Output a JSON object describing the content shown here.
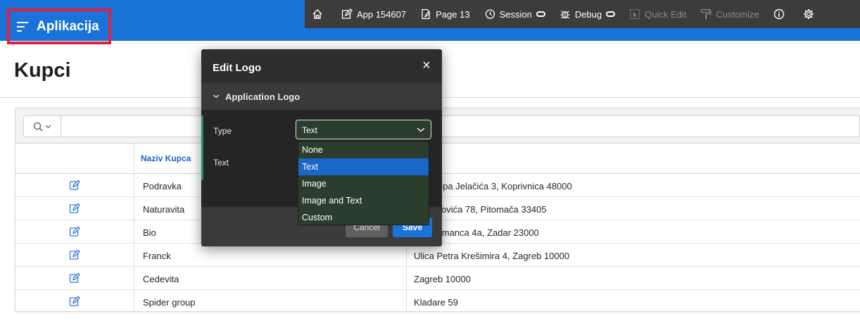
{
  "header": {
    "app_title": "Aplikacija"
  },
  "devbar": {
    "app_label": "App 154607",
    "page_label": "Page 13",
    "session_label": "Session",
    "debug_label": "Debug",
    "quick_edit_label": "Quick Edit",
    "customize_label": "Customize"
  },
  "page": {
    "title": "Kupci"
  },
  "report": {
    "column_name": "Naziv Kupca",
    "rows": [
      {
        "name": "Podravka",
        "address": "na Josipa Jelačića 3, Koprivnica 48000"
      },
      {
        "name": "Naturavita",
        "address": "Preradovića 78, Pitomača 33405"
      },
      {
        "name": "Bio",
        "address": "na Sulimanca 4a, Zadar 23000"
      },
      {
        "name": "Franck",
        "address": "Ulica Petra Krešimira 4, Zagreb 10000"
      },
      {
        "name": "Cedevita",
        "address": "Zagreb 10000"
      },
      {
        "name": "Spider group",
        "address": "Kladare 59"
      }
    ]
  },
  "dialog": {
    "title": "Edit Logo",
    "region_title": "Application Logo",
    "type_label": "Type",
    "type_value": "Text",
    "text_label": "Text",
    "cancel_label": "Cancel",
    "save_label": "Save",
    "options": [
      "None",
      "Text",
      "Image",
      "Image and Text",
      "Custom"
    ],
    "selected_option": "Text"
  },
  "colors": {
    "header_blue": "#1a73d9",
    "highlight_red": "#e0213a",
    "devbar_gray": "#3c3c3c",
    "dialog_dark": "#2e2e2e",
    "link_blue": "#1a66c9"
  }
}
